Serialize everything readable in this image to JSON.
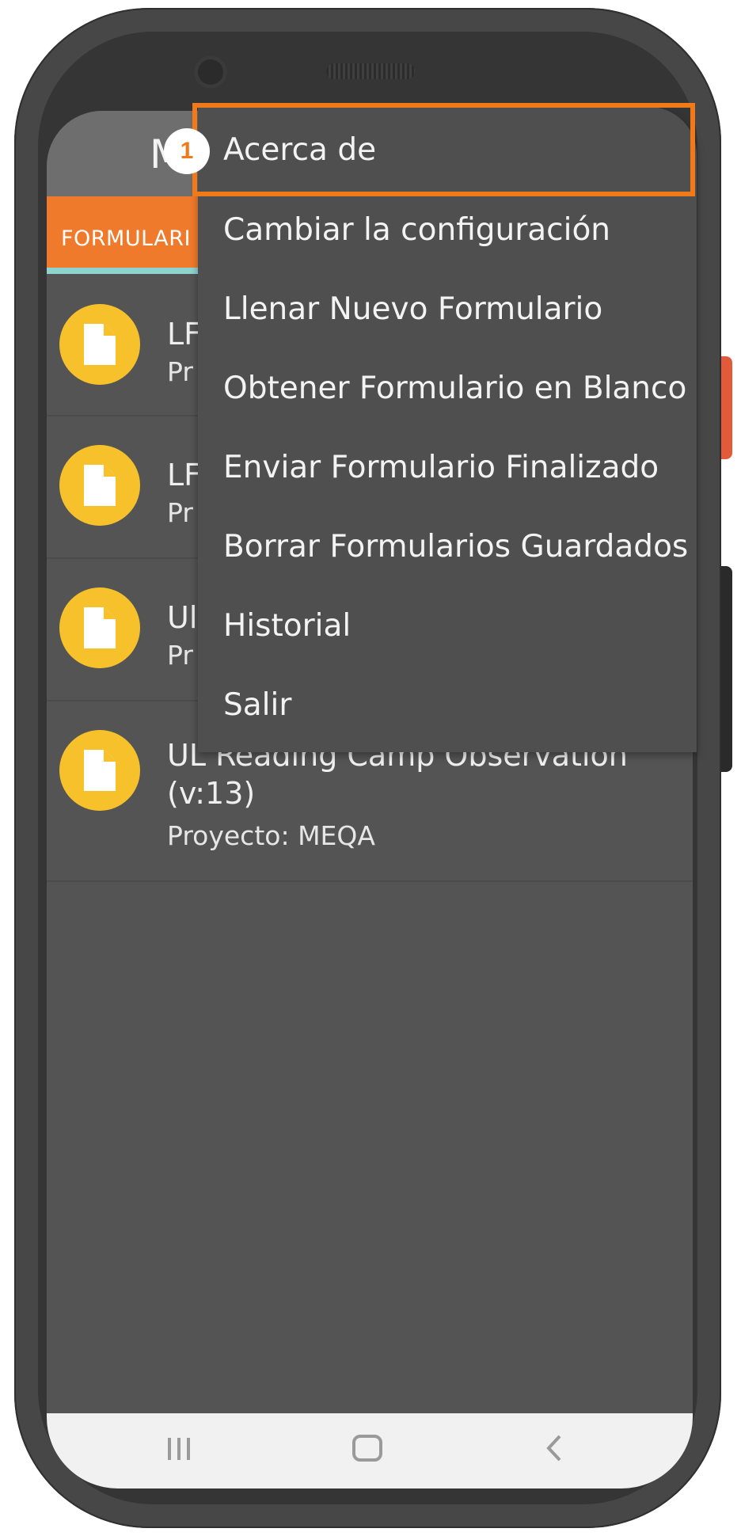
{
  "app": {
    "title_visible": "M"
  },
  "tabs": {
    "active_label": "FORMULARI"
  },
  "forms": [
    {
      "title": "LF",
      "subtitle": "Pr"
    },
    {
      "title": "LF",
      "subtitle": "Pr"
    },
    {
      "title": "Ul",
      "subtitle": "Pr"
    },
    {
      "title": "UL Reading Camp Observation (v:13)",
      "subtitle": "Proyecto: MEQA"
    }
  ],
  "menu": {
    "items": [
      "Acerca de",
      "Cambiar la configuración",
      "Llenar Nuevo Formulario",
      "Obtener Formulario en Blanco",
      "Enviar Formulario Finalizado",
      "Borrar Formularios Guardados",
      "Historial",
      "Salir"
    ]
  },
  "annotation": {
    "badge_number": "1"
  },
  "nav": {
    "recents_icon": "recent-apps-icon",
    "home_icon": "home-icon",
    "back_icon": "back-icon"
  },
  "colors": {
    "accent": "#f07a2c",
    "highlight": "#f07a1a",
    "icon_bg": "#f6c12a",
    "tab_indicator": "#8fd3cf"
  }
}
